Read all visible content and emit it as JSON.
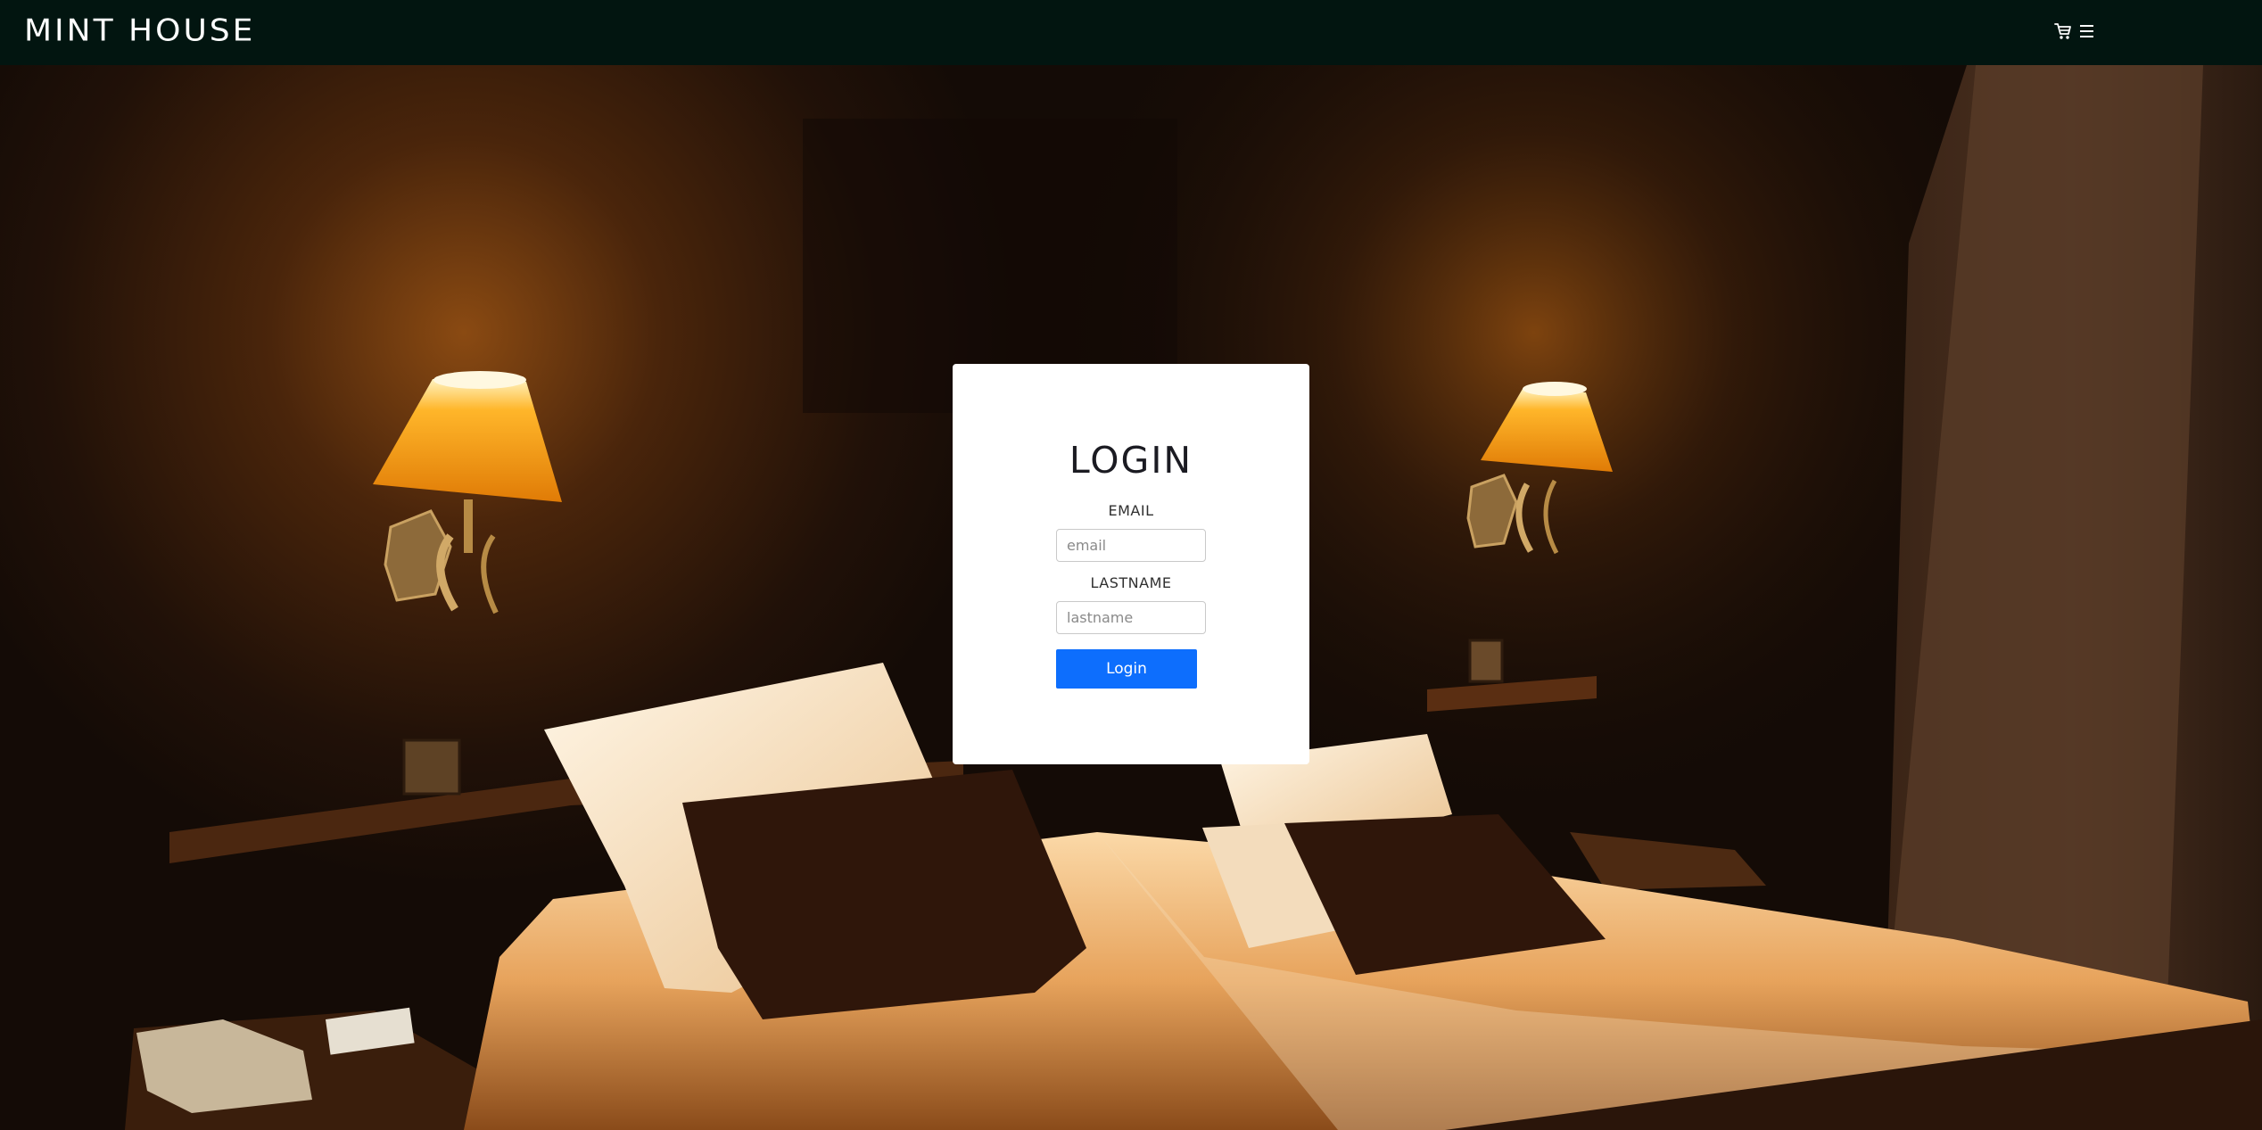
{
  "header": {
    "brand": "MINT HOUSE",
    "cart_icon": "cart-icon",
    "menu_icon": "hamburger-menu-icon",
    "background_color": "#021510"
  },
  "hero": {
    "image": "hotel-room-photo"
  },
  "login_form": {
    "title": "LOGIN",
    "email_label": "EMAIL",
    "email_placeholder": "email",
    "email_value": "",
    "lastname_label": "LASTNAME",
    "lastname_placeholder": "lastname",
    "lastname_value": "",
    "submit_label": "Login",
    "button_color": "#0d6efd"
  }
}
